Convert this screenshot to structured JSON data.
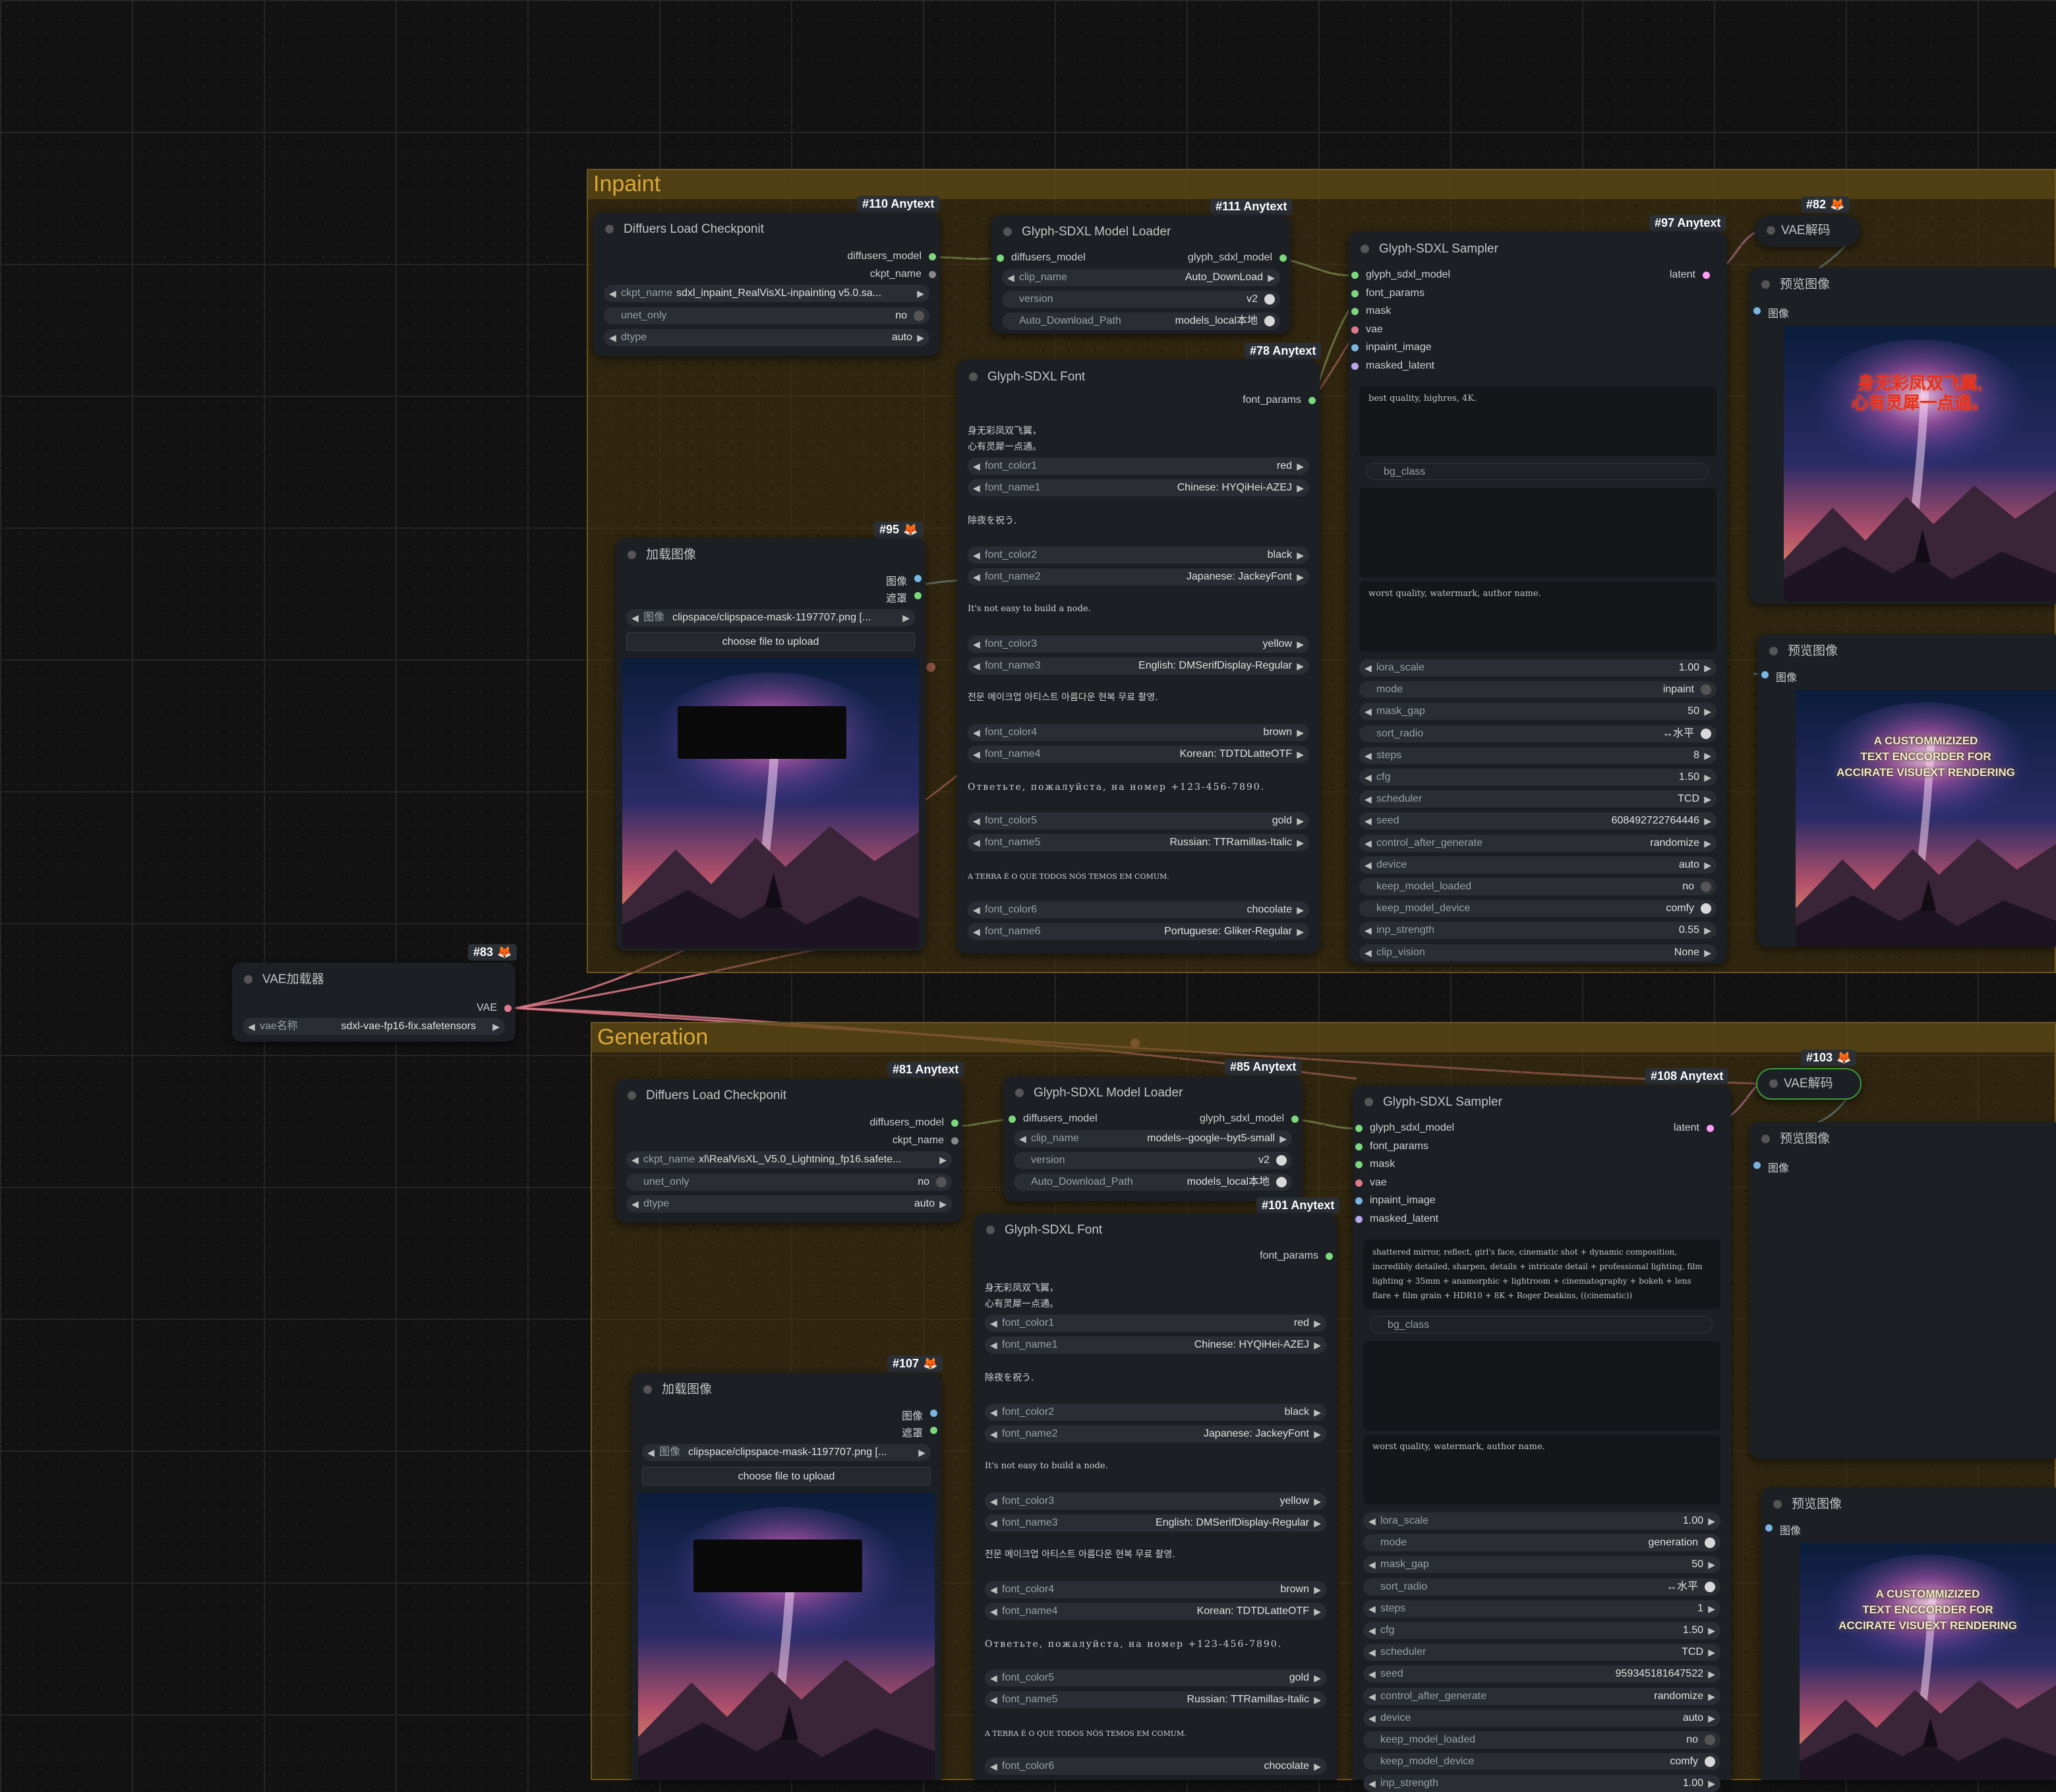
{
  "groups": {
    "inpaint": {
      "title": "Inpaint"
    },
    "generation": {
      "title": "Generation"
    }
  },
  "anytext_suffix": "Anytext",
  "nodes": {
    "vae_loader": {
      "badge": "#83",
      "title": "VAE加载器",
      "output": "VAE",
      "widget": {
        "name": "vae名称",
        "value": "sdxl-vae-fp16-fix.safetensors"
      }
    },
    "inpaint_checkpoint": {
      "badge": "#110",
      "title": "Diffuers Load Checkponit",
      "outputs": [
        "diffusers_model",
        "ckpt_name"
      ],
      "ckpt_name_label": "ckpt_name",
      "ckpt_name_value": "sdxl_inpaint_RealVisXL-inpainting v5.0.sa...",
      "unet_only_label": "unet_only",
      "unet_only_value": "no",
      "dtype_label": "dtype",
      "dtype_value": "auto"
    },
    "inpaint_loader": {
      "badge": "#111",
      "title": "Glyph-SDXL Model Loader",
      "input": "diffusers_model",
      "output": "glyph_sdxl_model",
      "clip_label": "clip_name",
      "clip_value": "Auto_DownLoad",
      "version_label": "version",
      "version_value": "v2",
      "path_label": "Auto_Download_Path",
      "path_value": "models_local本地"
    },
    "inpaint_sampler": {
      "badge": "#97",
      "title": "Glyph-SDXL Sampler",
      "inputs": [
        "glyph_sdxl_model",
        "font_params",
        "mask",
        "vae",
        "inpaint_image",
        "masked_latent"
      ],
      "output": "latent",
      "positive": "best quality, highres, 4K.",
      "bg_class": "bg_class",
      "negative": "worst quality, watermark, author name.",
      "widgets": [
        {
          "name": "lora_scale",
          "value": "1.00",
          "kind": "num"
        },
        {
          "name": "mode",
          "value": "inpaint",
          "kind": "toggle"
        },
        {
          "name": "mask_gap",
          "value": "50",
          "kind": "num"
        },
        {
          "name": "sort_radio",
          "value": "↔水平",
          "kind": "toggle-on"
        },
        {
          "name": "steps",
          "value": "8",
          "kind": "num"
        },
        {
          "name": "cfg",
          "value": "1.50",
          "kind": "num"
        },
        {
          "name": "scheduler",
          "value": "TCD",
          "kind": "num"
        },
        {
          "name": "seed",
          "value": "608492722764446",
          "kind": "num"
        },
        {
          "name": "control_after_generate",
          "value": "randomize",
          "kind": "num"
        },
        {
          "name": "device",
          "value": "auto",
          "kind": "num"
        },
        {
          "name": "keep_model_loaded",
          "value": "no",
          "kind": "toggle"
        },
        {
          "name": "keep_model_device",
          "value": "comfy",
          "kind": "toggle-on"
        },
        {
          "name": "inp_strength",
          "value": "0.55",
          "kind": "num"
        },
        {
          "name": "clip_vision",
          "value": "None",
          "kind": "num"
        }
      ]
    },
    "inpaint_font": {
      "badge": "#78",
      "title": "Glyph-SDXL Font",
      "output": "font_params",
      "texts": [
        "身无彩凤双飞翼，\n心有灵犀一点通。",
        "除夜を祝う.",
        "It's not easy to build a node.",
        "전문 메이크업 아티스트 아름다운 현복 무료 촬영.",
        "Ответьте, пожалуйста, на номер +123-456-7890.",
        "A TERRA É O QUE TODOS NÓS TEMOS EM COMUM."
      ],
      "pairs": [
        {
          "color_label": "font_color1",
          "color": "red",
          "name_label": "font_name1",
          "name": "Chinese: HYQiHei-AZEJ"
        },
        {
          "color_label": "font_color2",
          "color": "black",
          "name_label": "font_name2",
          "name": "Japanese: JackeyFont"
        },
        {
          "color_label": "font_color3",
          "color": "yellow",
          "name_label": "font_name3",
          "name": "English: DMSerifDisplay-Regular"
        },
        {
          "color_label": "font_color4",
          "color": "brown",
          "name_label": "font_name4",
          "name": "Korean: TDTDLatteOTF"
        },
        {
          "color_label": "font_color5",
          "color": "gold",
          "name_label": "font_name5",
          "name": "Russian: TTRamillas-Italic"
        },
        {
          "color_label": "font_color6",
          "color": "chocolate",
          "name_label": "font_name6",
          "name": "Portuguese: Gliker-Regular"
        }
      ]
    },
    "inpaint_loadimage": {
      "badge": "#95",
      "title": "加载图像",
      "outputs": [
        "图像",
        "遮罩"
      ],
      "image_label": "图像",
      "image_value": "clipspace/clipspace-mask-1197707.png [...",
      "upload": "choose file to upload"
    },
    "inpaint_vaedecode": {
      "badge": "#82",
      "title": "VAE解码"
    },
    "inpaint_preview1": {
      "title": "预览图像",
      "input": "图像",
      "caption": "身无彩凤双飞翼,\n心有灵犀一点通。"
    },
    "inpaint_preview2": {
      "title": "预览图像",
      "input": "图像",
      "caption": "A CUSTOMMIZIZED\nTEXT ENCCORDER  FOR\nACCIRATE VISUEXT RENDERING"
    },
    "gen_checkpoint": {
      "badge": "#81",
      "title": "Diffuers Load Checkponit",
      "outputs": [
        "diffusers_model",
        "ckpt_name"
      ],
      "ckpt_name_label": "ckpt_name",
      "ckpt_name_value": "xl\\RealVisXL_V5.0_Lightning_fp16.safete...",
      "unet_only_label": "unet_only",
      "unet_only_value": "no",
      "dtype_label": "dtype",
      "dtype_value": "auto"
    },
    "gen_loader": {
      "badge": "#85",
      "title": "Glyph-SDXL Model Loader",
      "input": "diffusers_model",
      "output": "glyph_sdxl_model",
      "clip_label": "clip_name",
      "clip_value": "models--google--byt5-small",
      "version_label": "version",
      "version_value": "v2",
      "path_label": "Auto_Download_Path",
      "path_value": "models_local本地"
    },
    "gen_sampler": {
      "badge": "#108",
      "title": "Glyph-SDXL Sampler",
      "inputs": [
        "glyph_sdxl_model",
        "font_params",
        "mask",
        "vae",
        "inpaint_image",
        "masked_latent"
      ],
      "output": "latent",
      "positive": "shattered mirror, reflect, girl's face, cinematic shot + dynamic composition, incredibly detailed, sharpen, details + intricate detail + professional lighting, film lighting + 35mm + anamorphic + lightroom + cinematography + bokeh + lens flare + film grain + HDR10 + 8K + Roger Deakins, ((cinematic))",
      "bg_class": "bg_class",
      "negative": "worst quality, watermark, author name.",
      "widgets": [
        {
          "name": "lora_scale",
          "value": "1.00",
          "kind": "num"
        },
        {
          "name": "mode",
          "value": "generation",
          "kind": "toggle-on"
        },
        {
          "name": "mask_gap",
          "value": "50",
          "kind": "num"
        },
        {
          "name": "sort_radio",
          "value": "↔水平",
          "kind": "toggle-on"
        },
        {
          "name": "steps",
          "value": "1",
          "kind": "num"
        },
        {
          "name": "cfg",
          "value": "1.50",
          "kind": "num"
        },
        {
          "name": "scheduler",
          "value": "TCD",
          "kind": "num"
        },
        {
          "name": "seed",
          "value": "959345181647522",
          "kind": "num"
        },
        {
          "name": "control_after_generate",
          "value": "randomize",
          "kind": "num"
        },
        {
          "name": "device",
          "value": "auto",
          "kind": "num"
        },
        {
          "name": "keep_model_loaded",
          "value": "no",
          "kind": "toggle"
        },
        {
          "name": "keep_model_device",
          "value": "comfy",
          "kind": "toggle-on"
        },
        {
          "name": "inp_strength",
          "value": "1.00",
          "kind": "num"
        }
      ]
    },
    "gen_font": {
      "badge": "#101",
      "title": "Glyph-SDXL Font",
      "output": "font_params",
      "texts": [
        "身无彩凤双飞翼，\n心有灵犀一点通。",
        "除夜を祝う.",
        "It's not easy to build a node.",
        "전문 메이크업 아티스트 아름다운 현복 무료 촬영.",
        "Ответьте, пожалуйста, на номер +123-456-7890.",
        "A TERRA É O QUE TODOS NÓS TEMOS EM COMUM."
      ],
      "pairs": [
        {
          "color_label": "font_color1",
          "color": "red",
          "name_label": "font_name1",
          "name": "Chinese: HYQiHei-AZEJ"
        },
        {
          "color_label": "font_color2",
          "color": "black",
          "name_label": "font_name2",
          "name": "Japanese: JackeyFont"
        },
        {
          "color_label": "font_color3",
          "color": "yellow",
          "name_label": "font_name3",
          "name": "English: DMSerifDisplay-Regular"
        },
        {
          "color_label": "font_color4",
          "color": "brown",
          "name_label": "font_name4",
          "name": "Korean: TDTDLatteOTF"
        },
        {
          "color_label": "font_color5",
          "color": "gold",
          "name_label": "font_name5",
          "name": "Russian: TTRamillas-Italic"
        },
        {
          "color_label": "font_color6",
          "color": "chocolate",
          "name_label": "",
          "name": ""
        }
      ]
    },
    "gen_loadimage": {
      "badge": "#107",
      "title": "加载图像",
      "outputs": [
        "图像",
        "遮罩"
      ],
      "image_label": "图像",
      "image_value": "clipspace/clipspace-mask-1197707.png [...",
      "upload": "choose file to upload"
    },
    "gen_vaedecode": {
      "badge": "#103",
      "title": "VAE解码"
    },
    "gen_preview1": {
      "title": "预览图像",
      "input": "图像"
    },
    "gen_preview2": {
      "title": "预览图像",
      "input": "图像",
      "caption": "A CUSTOMMIZIZED\nTEXT ENCCORDER  FOR\nACCIRATE VISUEXT RENDERING"
    }
  },
  "colors": {
    "accent_wire": "#e07a8a",
    "model_wire": "#9fd08a",
    "latent_wire": "#ff9cf9",
    "group_title": "#d8a83a",
    "pin_green": "#7dd87d",
    "pin_pink": "#e07a8a",
    "pin_blue": "#7ab6e0",
    "pin_lavender": "#b8a6e8",
    "caption_red": "#e8301c",
    "caption_gold": "#f4ecc8"
  }
}
